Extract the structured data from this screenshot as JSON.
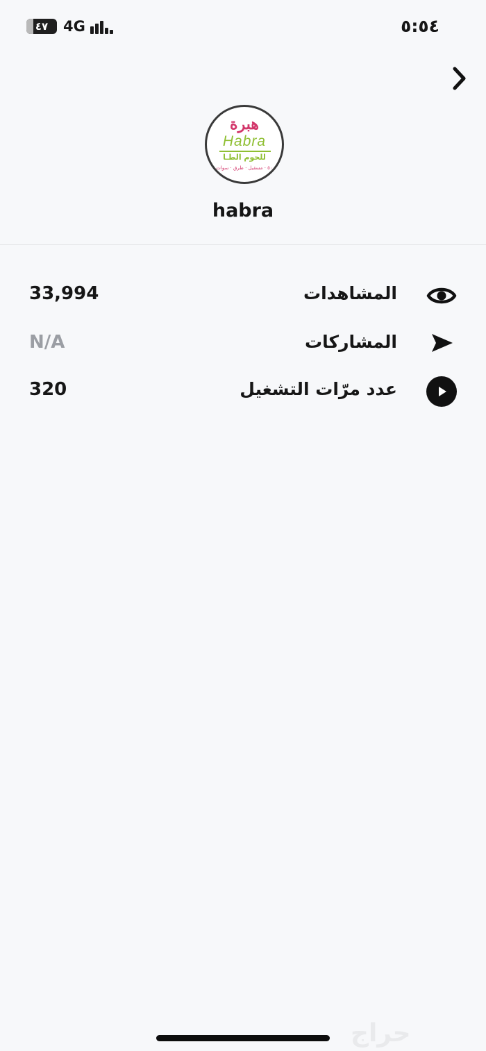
{
  "status_bar": {
    "battery": "٤٧",
    "network": "4G",
    "time": "٥:٥٤"
  },
  "profile": {
    "logo": {
      "arabic": "هبرة",
      "latin": "Habra",
      "tagline": "للحوم الطـا",
      "sub": "٥٠ · مسقيل · طرق · سوات"
    },
    "username": "habra"
  },
  "stats": [
    {
      "label": "المشاهدات",
      "value": "33,994",
      "icon": "eye-icon"
    },
    {
      "label": "المشاركات",
      "value": "N/A",
      "icon": "send-icon"
    },
    {
      "label": "عدد مرّات التشغيل",
      "value": "320",
      "icon": "play-icon"
    }
  ],
  "watermark": "حراج",
  "colors": {
    "background": "#f7f8fa",
    "text": "#161616",
    "muted": "#9b9ea4",
    "logo_pink": "#d2366a",
    "logo_green": "#8fbf33"
  }
}
